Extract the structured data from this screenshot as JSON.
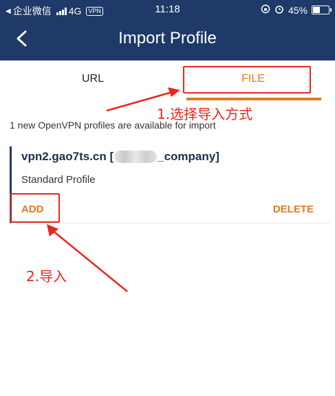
{
  "status_bar": {
    "carrier": "企业微信",
    "network": "4G",
    "vpn": "VPN",
    "time": "11:18",
    "battery": "45%",
    "battery_level": 0.45
  },
  "header": {
    "title": "Import Profile"
  },
  "tabs": [
    {
      "label": "URL"
    },
    {
      "label": "FILE"
    }
  ],
  "notice": "1 new OpenVPN profiles are available for import",
  "profile": {
    "name_prefix": "vpn2.gao7ts.cn [",
    "name_suffix": "_company]",
    "type": "Standard Profile",
    "add_label": "ADD",
    "delete_label": "DELETE"
  },
  "annotations": {
    "step1": "1.选择导入方式",
    "step2": "2.导入"
  },
  "colors": {
    "header_bg": "#1f3a68",
    "accent": "#e07a20",
    "annotation_red": "#e8261f"
  }
}
